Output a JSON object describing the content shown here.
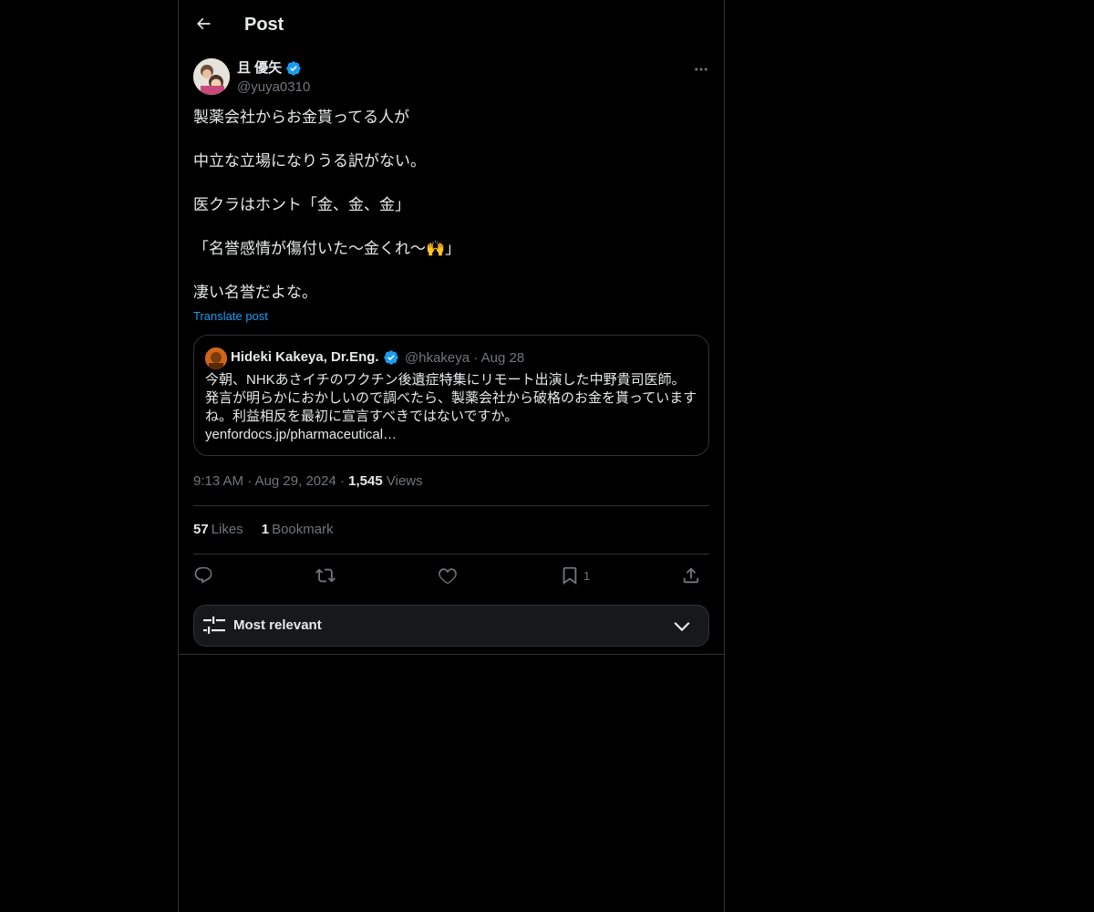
{
  "header": {
    "title": "Post"
  },
  "post": {
    "author": {
      "name": "且 優矢",
      "handle": "@yuya0310"
    },
    "lines": [
      "製薬会社からお金貰ってる人が",
      "",
      "中立な立場になりうる訳がない。",
      "",
      "医クラはホント「金、金、金」",
      "",
      "「名誉感情が傷付いた〜金くれ〜🙌」",
      "",
      "凄い名誉だよな。"
    ],
    "translate_label": "Translate post"
  },
  "quote": {
    "name": "Hideki Kakeya, Dr.Eng.",
    "handle": "@hkakeya",
    "date": "Aug 28",
    "lines": [
      "今朝、NHKあさイチのワクチン後遺症特集にリモート出演した中野貴司医師。",
      "発言が明らかにおかしいので調べたら、製薬会社から破格のお金を貰っています",
      "ね。利益相反を最初に宣言すべきではないですか。",
      "yenfordocs.jp/pharmaceutical…"
    ]
  },
  "meta": {
    "time": "9:13 AM",
    "date": "Aug 29, 2024",
    "views_count": "1,545",
    "views_label": "Views"
  },
  "stats": {
    "likes_count": "57",
    "likes_label": "Likes",
    "bookmarks_count": "1",
    "bookmarks_label": "Bookmark"
  },
  "actions": {
    "bookmark_count": "1"
  },
  "sort": {
    "label": "Most relevant"
  },
  "colors": {
    "background": "#000000",
    "text": "#e7e9ea",
    "muted": "#71767b",
    "accent": "#1d9bf0",
    "border": "#2f3336",
    "verified": "#1d9bf0"
  }
}
